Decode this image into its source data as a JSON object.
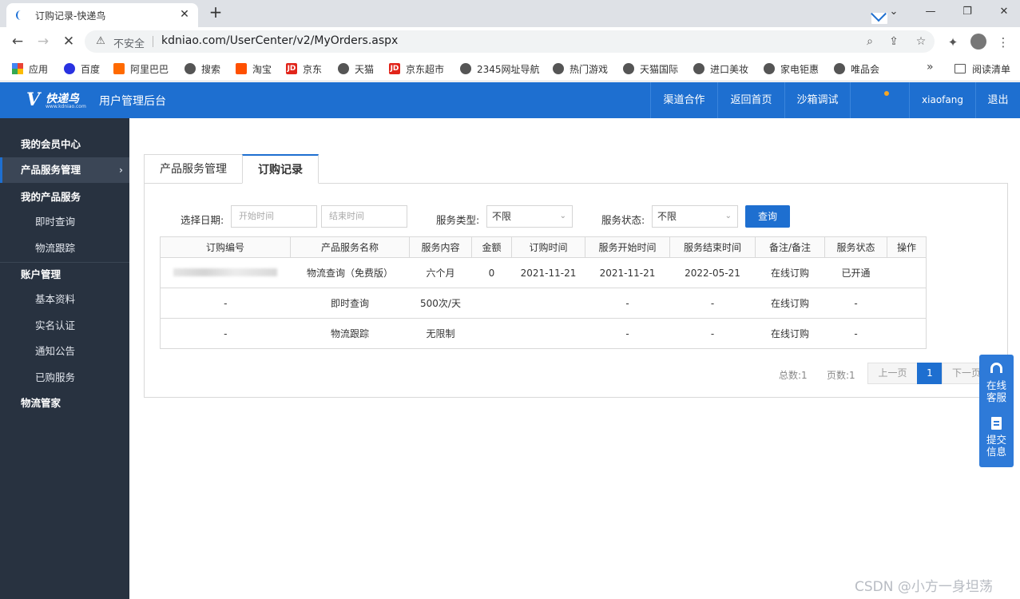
{
  "browser": {
    "tab_title": "订购记录-快递鸟",
    "insecure_label": "不安全",
    "url": "kdniao.com/UserCenter/v2/MyOrders.aspx",
    "bookmarks": [
      "应用",
      "百度",
      "阿里巴巴",
      "搜索",
      "淘宝",
      "京东",
      "天猫",
      "京东超市",
      "2345网址导航",
      "热门游戏",
      "天猫国际",
      "进口美妆",
      "家电钜惠",
      "唯品会"
    ],
    "more": "»",
    "reading_list": "阅读清单"
  },
  "header": {
    "logo_text": "快递鸟",
    "logo_sub": "www.kdniao.com",
    "title": "用户管理后台",
    "nav": [
      "渠道合作",
      "返回首页",
      "沙箱调试"
    ],
    "username": "xiaofang",
    "logout": "退出"
  },
  "sidebar": {
    "items": [
      {
        "label": "我的会员中心"
      },
      {
        "label": "产品服务管理"
      },
      {
        "label": "我的产品服务"
      },
      {
        "label": "即时查询"
      },
      {
        "label": "物流跟踪"
      },
      {
        "label": "账户管理"
      },
      {
        "label": "基本资料"
      },
      {
        "label": "实名认证"
      },
      {
        "label": "通知公告"
      },
      {
        "label": "已购服务"
      },
      {
        "label": "物流管家"
      }
    ]
  },
  "tabs": [
    "产品服务管理",
    "订购记录"
  ],
  "filters": {
    "date_label": "选择日期:",
    "start_placeholder": "开始时间",
    "end_placeholder": "结束时间",
    "type_label": "服务类型:",
    "type_value": "不限",
    "status_label": "服务状态:",
    "status_value": "不限",
    "query_button": "查询"
  },
  "table": {
    "headers": [
      "订购编号",
      "产品服务名称",
      "服务内容",
      "金额",
      "订购时间",
      "服务开始时间",
      "服务结束时间",
      "备注/备注",
      "服务状态",
      "操作"
    ],
    "rows": [
      [
        "",
        "物流查询（免费版）",
        "六个月",
        "0",
        "2021-11-21",
        "2021-11-21",
        "2022-05-21",
        "在线订购",
        "已开通",
        ""
      ],
      [
        "-",
        "即时查询",
        "500次/天",
        "",
        "",
        "-",
        "-",
        "在线订购",
        "-",
        ""
      ],
      [
        "-",
        "物流跟踪",
        "无限制",
        "",
        "",
        "-",
        "-",
        "在线订购",
        "-",
        ""
      ]
    ]
  },
  "pager": {
    "total": "总数:1",
    "pages": "页数:1",
    "prev": "上一页",
    "current": "1",
    "next": "下一页"
  },
  "float_widget": {
    "service": "在线客服",
    "submit": "提交信息"
  },
  "watermark": "CSDN @小方一身坦荡",
  "colors": {
    "brand": "#1e6fd0",
    "sidebar_bg": "#283240"
  }
}
